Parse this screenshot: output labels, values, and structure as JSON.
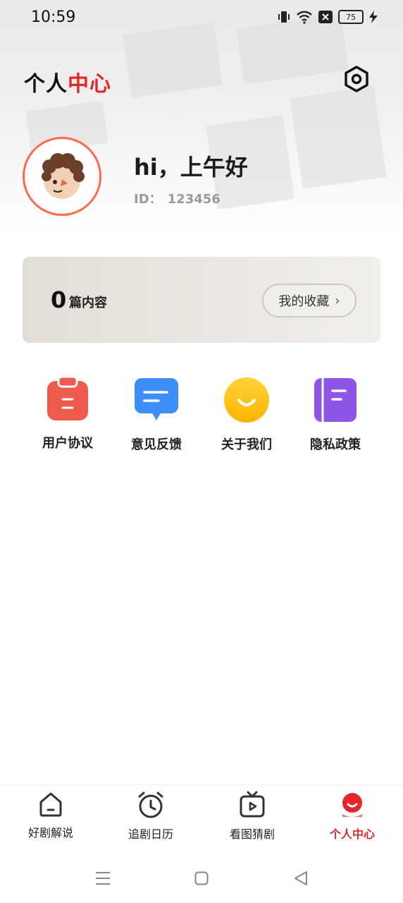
{
  "status_bar": {
    "time": "10:59",
    "battery": "75"
  },
  "header": {
    "title_part1": "个人",
    "title_part2": "中心"
  },
  "profile": {
    "greeting": "hi，上午好",
    "id_label": "ID：",
    "id_value": "123456"
  },
  "favorites_card": {
    "count": "0",
    "count_label": "篇内容",
    "button_label": "我的收藏"
  },
  "shortcuts": [
    {
      "label": "用户协议",
      "icon": "clipboard-icon",
      "color": "#ef5a4f"
    },
    {
      "label": "意见反馈",
      "icon": "chat-bubble-icon",
      "color": "#3d8ef6"
    },
    {
      "label": "关于我们",
      "icon": "smile-icon",
      "color": "#ffc21d"
    },
    {
      "label": "隐私政策",
      "icon": "notebook-icon",
      "color": "#8d56e6"
    }
  ],
  "bottom_nav": [
    {
      "label": "好剧解说",
      "icon": "home-icon",
      "active": false
    },
    {
      "label": "追剧日历",
      "icon": "alarm-clock-icon",
      "active": false
    },
    {
      "label": "看图猜剧",
      "icon": "tv-play-icon",
      "active": false
    },
    {
      "label": "个人中心",
      "icon": "profile-icon",
      "active": true
    }
  ],
  "colors": {
    "accent": "#e4272a",
    "avatar_ring": "#ff6a4a"
  }
}
